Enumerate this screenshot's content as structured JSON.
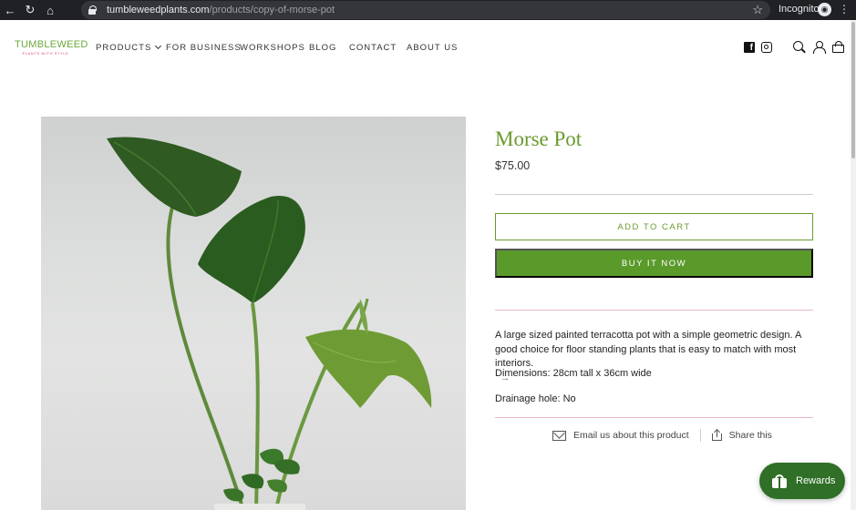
{
  "browser": {
    "url_host": "tumbleweedplants.com",
    "url_path": "/products/copy-of-morse-pot",
    "mode_label": "Incognito"
  },
  "header": {
    "logo_name": "TUMBLEWEED",
    "logo_tagline": "PLANTS WITH STYLE",
    "nav": [
      "PRODUCTS",
      "FOR BUSINESS",
      "WORKSHOPS",
      "BLOG",
      "CONTACT",
      "ABOUT US"
    ]
  },
  "product": {
    "title": "Morse Pot",
    "price": "$75.00",
    "add_to_cart": "ADD TO CART",
    "buy_now": "BUY IT NOW",
    "description": "A large sized painted terracotta pot with a simple geometric design. A good choice for floor standing plants that is easy to match with most interiors.",
    "dimensions": "Dimensions: 28cm tall x 36cm wide",
    "drainage": "Drainage hole: No",
    "email_label": "Email us about this product",
    "share_label": "Share this"
  },
  "rewards": {
    "label": "Rewards"
  },
  "colors": {
    "brand_green": "#6a9b2d",
    "button_green": "#5a9a2b",
    "rewards_green": "#2f6f27",
    "logo_pink": "#d9457c"
  }
}
